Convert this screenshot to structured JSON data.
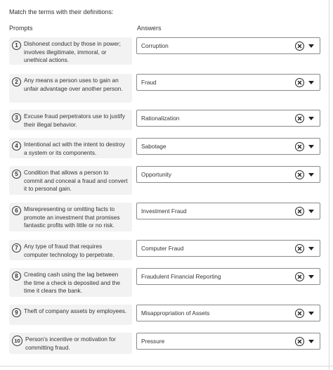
{
  "instruction": "Match the terms with their definitions:",
  "headers": {
    "prompts": "Prompts",
    "answers": "Answers"
  },
  "items": [
    {
      "num": "1",
      "prompt": "Dishonest conduct by those in power; involves illegitimate, immoral, or unethical actions.",
      "answer": "Corruption"
    },
    {
      "num": "2",
      "prompt": "Any means a person uses to gain an unfair advantage over another person.",
      "answer": "Fraud"
    },
    {
      "num": "3",
      "prompt": "Excuse fraud perpetrators use to justify their illegal behavior.",
      "answer": "Rationalization"
    },
    {
      "num": "4",
      "prompt": "Intentional act with the intent to destroy a system or its components.",
      "answer": "Sabotage"
    },
    {
      "num": "5",
      "prompt": "Condition that allows a person to commit and conceal a fraud and convert it to personal gain.",
      "answer": "Opportunity"
    },
    {
      "num": "6",
      "prompt": "Misrepresenting or omitting facts to promote an investment that promises fantastic profits with little or no risk.",
      "answer": "Investment Fraud"
    },
    {
      "num": "7",
      "prompt": "Any type of fraud that requires computer technology to perpetrate.",
      "answer": "Computer Fraud"
    },
    {
      "num": "8",
      "prompt": "Creating cash using the lag between the time a check is deposited and the time it clears the bank.",
      "answer": "Fraudulent Financial Reporting"
    },
    {
      "num": "9",
      "prompt": "Theft of company assets by employees.",
      "answer": "Misappropriation of Assets"
    },
    {
      "num": "10",
      "prompt": "Person's incentive or motivation for committing fraud.",
      "answer": "Pressure"
    }
  ],
  "icons": {
    "clear": "close-circle-icon",
    "dropdown": "caret-down-icon"
  }
}
